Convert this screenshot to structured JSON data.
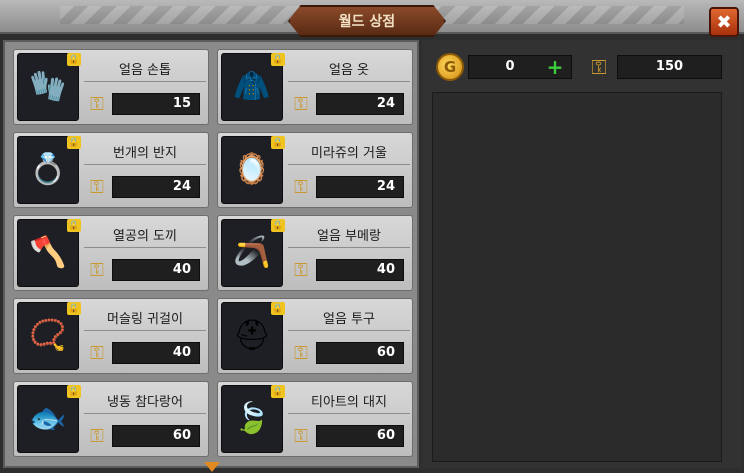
{
  "title": "월드 상점",
  "close_label": "✖",
  "currency": {
    "gold_icon_letter": "G",
    "gold_value": "0",
    "plus_label": "+",
    "key_value": "150"
  },
  "lock_glyph": "🔒",
  "key_glyph": "⚿",
  "items": [
    {
      "name": "얼음 손톱",
      "price": "15",
      "icon": "ice-claw-icon",
      "glyph": "🧤"
    },
    {
      "name": "얼음 옷",
      "price": "24",
      "icon": "ice-clothes-icon",
      "glyph": "🧥"
    },
    {
      "name": "번개의 반지",
      "price": "24",
      "icon": "lightning-ring-icon",
      "glyph": "💍"
    },
    {
      "name": "미라쥬의 거울",
      "price": "24",
      "icon": "mirage-mirror-icon",
      "glyph": "🪞"
    },
    {
      "name": "열공의 도끼",
      "price": "40",
      "icon": "fire-axe-icon",
      "glyph": "🪓"
    },
    {
      "name": "얼음 부메랑",
      "price": "40",
      "icon": "ice-boomerang-icon",
      "glyph": "🪃"
    },
    {
      "name": "머슬링 귀걸이",
      "price": "40",
      "icon": "earring-icon",
      "glyph": "📿"
    },
    {
      "name": "얼음 투구",
      "price": "60",
      "icon": "ice-helmet-icon",
      "glyph": "⛑"
    },
    {
      "name": "냉동 참다랑어",
      "price": "60",
      "icon": "frozen-tuna-icon",
      "glyph": "🐟"
    },
    {
      "name": "티아트의 대지",
      "price": "60",
      "icon": "earth-leaf-icon",
      "glyph": "🍃"
    }
  ],
  "colors": {
    "title_plate": "#7a3e20",
    "close": "#d0501e",
    "price_bg": "#1f1f1f",
    "gold": "#f0b030",
    "plus": "#3ccd3c"
  }
}
